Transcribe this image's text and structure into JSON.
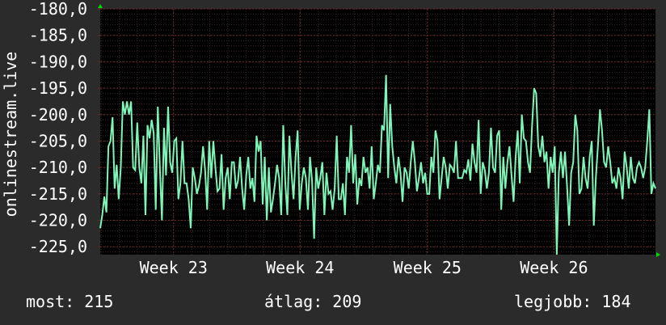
{
  "footer": {
    "now_label": "most:",
    "now_value": "215",
    "avg_label": "átlag:",
    "avg_value": "209",
    "best_label": "legjobb:",
    "best_value": "184"
  },
  "colors": {
    "background": "#2b2b2b",
    "plot_background": "#000000",
    "grid_major": "#6b2b2b",
    "grid_minor": "#3a2a2a",
    "line": "#7ff5b8",
    "axis_arrow": "#00dd00",
    "text": "#ffffff"
  },
  "chart_data": {
    "type": "line",
    "title": "",
    "ylabel": "onlinestream.live",
    "xlabel": "",
    "ylim": [
      -226.5,
      -180
    ],
    "xlim": [
      0,
      689
    ],
    "y_ticks": [
      -180,
      -185,
      -190,
      -195,
      -200,
      -205,
      -210,
      -215,
      -220,
      -225
    ],
    "y_tick_labels": [
      "-180,0",
      "-185,0",
      "-190,0",
      "-195,0",
      "-200,0",
      "-205,0",
      "-210,0",
      "-215,0",
      "-220,0",
      "-225,0"
    ],
    "x_ticks": [
      {
        "x": 91,
        "label": "Week 23"
      },
      {
        "x": 248,
        "label": "Week 24"
      },
      {
        "x": 406,
        "label": "Week 25"
      },
      {
        "x": 563,
        "label": "Week 26"
      }
    ],
    "grid": true,
    "series": [
      {
        "values": [
          [
            0,
            -221.5
          ],
          [
            3,
            -219
          ],
          [
            6,
            -215.5
          ],
          [
            9,
            -218.5
          ],
          [
            12,
            -206
          ],
          [
            15,
            -205
          ],
          [
            18,
            -200.5
          ],
          [
            21,
            -214
          ],
          [
            24,
            -209.5
          ],
          [
            27,
            -216
          ],
          [
            30,
            -210
          ],
          [
            33,
            -197.5
          ],
          [
            36,
            -200
          ],
          [
            39,
            -197.5
          ],
          [
            42,
            -200
          ],
          [
            45,
            -197.5
          ],
          [
            48,
            -210
          ],
          [
            51,
            -210.5
          ],
          [
            54,
            -201.5
          ],
          [
            57,
            -210
          ],
          [
            60,
            -213
          ],
          [
            63,
            -204
          ],
          [
            66,
            -219
          ],
          [
            69,
            -202
          ],
          [
            72,
            -204.5
          ],
          [
            75,
            -201
          ],
          [
            78,
            -203.5
          ],
          [
            81,
            -218
          ],
          [
            84,
            -198.5
          ],
          [
            87,
            -210
          ],
          [
            90,
            -220
          ],
          [
            93,
            -202.5
          ],
          [
            96,
            -211.5
          ],
          [
            99,
            -198.5
          ],
          [
            102,
            -209
          ],
          [
            105,
            -211
          ],
          [
            108,
            -205
          ],
          [
            111,
            -204.5
          ],
          [
            114,
            -216
          ],
          [
            117,
            -213
          ],
          [
            120,
            -205
          ],
          [
            123,
            -213
          ],
          [
            126,
            -213
          ],
          [
            129,
            -216
          ],
          [
            132,
            -221.5
          ],
          [
            135,
            -210
          ],
          [
            138,
            -212
          ],
          [
            141,
            -215
          ],
          [
            144,
            -213.5
          ],
          [
            147,
            -211
          ],
          [
            150,
            -206
          ],
          [
            153,
            -210.5
          ],
          [
            156,
            -218
          ],
          [
            159,
            -205
          ],
          [
            162,
            -212
          ],
          [
            165,
            -205
          ],
          [
            168,
            -210
          ],
          [
            171,
            -214.5
          ],
          [
            174,
            -214
          ],
          [
            177,
            -207.5
          ],
          [
            180,
            -218
          ],
          [
            183,
            -212
          ],
          [
            186,
            -210
          ],
          [
            189,
            -216
          ],
          [
            192,
            -209
          ],
          [
            195,
            -209
          ],
          [
            198,
            -214
          ],
          [
            201,
            -212.5
          ],
          [
            204,
            -208
          ],
          [
            207,
            -214
          ],
          [
            210,
            -218
          ],
          [
            213,
            -211.5
          ],
          [
            216,
            -208
          ],
          [
            219,
            -214
          ],
          [
            222,
            -212
          ],
          [
            225,
            -216.5
          ],
          [
            228,
            -204
          ],
          [
            231,
            -207
          ],
          [
            234,
            -205
          ],
          [
            237,
            -217
          ],
          [
            240,
            -208
          ],
          [
            243,
            -220
          ],
          [
            246,
            -210
          ],
          [
            249,
            -218.5
          ],
          [
            252,
            -216
          ],
          [
            255,
            -213
          ],
          [
            258,
            -209.5
          ],
          [
            261,
            -212
          ],
          [
            264,
            -219
          ],
          [
            267,
            -202
          ],
          [
            270,
            -213
          ],
          [
            273,
            -219
          ],
          [
            276,
            -204
          ],
          [
            279,
            -211
          ],
          [
            282,
            -216
          ],
          [
            285,
            -208
          ],
          [
            288,
            -203
          ],
          [
            291,
            -218
          ],
          [
            294,
            -213
          ],
          [
            297,
            -210
          ],
          [
            300,
            -212
          ],
          [
            303,
            -218
          ],
          [
            306,
            -208
          ],
          [
            309,
            -212.5
          ],
          [
            312,
            -223.5
          ],
          [
            315,
            -210
          ],
          [
            318,
            -214
          ],
          [
            321,
            -212
          ],
          [
            324,
            -209
          ],
          [
            327,
            -219
          ],
          [
            330,
            -211
          ],
          [
            333,
            -215
          ],
          [
            336,
            -214.5
          ],
          [
            339,
            -218
          ],
          [
            342,
            -214
          ],
          [
            345,
            -204
          ],
          [
            348,
            -216
          ],
          [
            351,
            -216
          ],
          [
            354,
            -213
          ],
          [
            357,
            -219
          ],
          [
            360,
            -208
          ],
          [
            363,
            -211
          ],
          [
            366,
            -202
          ],
          [
            369,
            -213
          ],
          [
            372,
            -207.5
          ],
          [
            375,
            -217
          ],
          [
            378,
            -212
          ],
          [
            381,
            -213.5
          ],
          [
            384,
            -208
          ],
          [
            387,
            -211
          ],
          [
            390,
            -210
          ],
          [
            393,
            -214
          ],
          [
            396,
            -206
          ],
          [
            399,
            -216
          ],
          [
            402,
            -213
          ],
          [
            405,
            -209.5
          ],
          [
            408,
            -211
          ],
          [
            411,
            -202
          ],
          [
            414,
            -203
          ],
          [
            417,
            -192.5
          ],
          [
            420,
            -212
          ],
          [
            423,
            -198
          ],
          [
            426,
            -206
          ],
          [
            429,
            -210
          ],
          [
            432,
            -213
          ],
          [
            435,
            -208
          ],
          [
            438,
            -211
          ],
          [
            441,
            -216.5
          ],
          [
            444,
            -210
          ],
          [
            447,
            -211
          ],
          [
            450,
            -214
          ],
          [
            453,
            -209
          ],
          [
            456,
            -205
          ],
          [
            459,
            -209
          ],
          [
            462,
            -214.5
          ],
          [
            465,
            -212
          ],
          [
            468,
            -209
          ],
          [
            471,
            -213
          ],
          [
            474,
            -211
          ],
          [
            477,
            -215
          ],
          [
            480,
            -215
          ],
          [
            483,
            -208
          ],
          [
            486,
            -211
          ],
          [
            489,
            -203
          ],
          [
            492,
            -205
          ],
          [
            495,
            -216
          ],
          [
            498,
            -212
          ],
          [
            501,
            -208
          ],
          [
            504,
            -210
          ],
          [
            507,
            -214
          ],
          [
            510,
            -209.5
          ],
          [
            513,
            -210
          ],
          [
            516,
            -211
          ],
          [
            519,
            -205
          ],
          [
            522,
            -212
          ],
          [
            525,
            -212
          ],
          [
            528,
            -212
          ],
          [
            531,
            -210.5
          ],
          [
            534,
            -211
          ],
          [
            537,
            -208.5
          ],
          [
            540,
            -212.5
          ],
          [
            543,
            -205.5
          ],
          [
            546,
            -209
          ],
          [
            549,
            -211
          ],
          [
            552,
            -201
          ],
          [
            555,
            -215
          ],
          [
            558,
            -209
          ],
          [
            561,
            -210.5
          ],
          [
            564,
            -214
          ],
          [
            567,
            -211
          ],
          [
            570,
            -202.5
          ],
          [
            573,
            -210
          ],
          [
            576,
            -211
          ],
          [
            579,
            -204
          ],
          [
            582,
            -203
          ],
          [
            585,
            -218
          ],
          [
            588,
            -208
          ],
          [
            591,
            -214
          ],
          [
            594,
            -209
          ],
          [
            597,
            -206
          ],
          [
            600,
            -211.5
          ],
          [
            603,
            -216.5
          ],
          [
            606,
            -208
          ],
          [
            609,
            -203
          ],
          [
            612,
            -213
          ],
          [
            615,
            -200
          ],
          [
            618,
            -204.5
          ],
          [
            621,
            -205
          ],
          [
            624,
            -209
          ],
          [
            627,
            -211
          ],
          [
            630,
            -202
          ],
          [
            633,
            -195
          ],
          [
            636,
            -196
          ],
          [
            639,
            -206
          ],
          [
            642,
            -208
          ],
          [
            645,
            -204
          ],
          [
            648,
            -209
          ],
          [
            651,
            -207
          ],
          [
            654,
            -214
          ],
          [
            657,
            -208
          ],
          [
            660,
            -211
          ],
          [
            663,
            -206
          ],
          [
            666,
            -226.5
          ],
          [
            669,
            -211
          ],
          [
            672,
            -207
          ],
          [
            675,
            -212
          ],
          [
            678,
            -207
          ],
          [
            681,
            -213.5
          ],
          [
            684,
            -221
          ],
          [
            687,
            -211
          ],
          [
            690,
            -209
          ],
          [
            693,
            -200
          ],
          [
            696,
            -203
          ],
          [
            699,
            -215
          ],
          [
            702,
            -214
          ],
          [
            705,
            -208
          ],
          [
            708,
            -212
          ],
          [
            711,
            -214
          ],
          [
            714,
            -208
          ],
          [
            717,
            -205
          ],
          [
            720,
            -221
          ],
          [
            723,
            -212
          ],
          [
            726,
            -206
          ],
          [
            729,
            -199
          ],
          [
            732,
            -203
          ],
          [
            735,
            -209
          ],
          [
            738,
            -210
          ],
          [
            741,
            -206
          ],
          [
            744,
            -209
          ],
          [
            747,
            -213
          ],
          [
            750,
            -212
          ],
          [
            753,
            -214
          ],
          [
            756,
            -210
          ],
          [
            759,
            -212
          ],
          [
            762,
            -216
          ],
          [
            765,
            -207
          ],
          [
            768,
            -210
          ],
          [
            771,
            -214
          ],
          [
            774,
            -208
          ],
          [
            777,
            -212
          ],
          [
            780,
            -213
          ],
          [
            783,
            -210
          ],
          [
            786,
            -209
          ],
          [
            789,
            -210
          ],
          [
            792,
            -212
          ],
          [
            795,
            -210
          ],
          [
            798,
            -205
          ],
          [
            801,
            -199
          ],
          [
            804,
            -215
          ],
          [
            807,
            -213
          ],
          [
            810,
            -214
          ]
        ]
      }
    ]
  }
}
